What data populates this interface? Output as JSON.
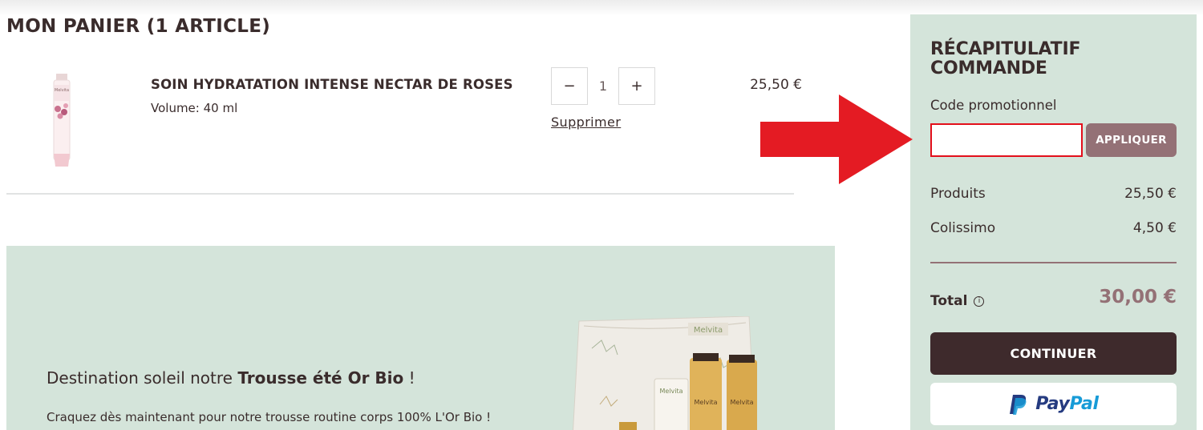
{
  "cart": {
    "title": "MON PANIER (1 ARTICLE)",
    "item": {
      "name": "SOIN HYDRATATION INTENSE NECTAR DE ROSES",
      "variant": "Volume: 40 ml",
      "quantity": "1",
      "decrease_label": "−",
      "increase_label": "+",
      "remove_label": "Supprimer",
      "price": "25,50 €",
      "image_brand": "Melvita"
    }
  },
  "banner": {
    "headline_prefix": "Destination soleil notre ",
    "headline_bold": "Trousse été Or Bio",
    "headline_suffix": " !",
    "text": "Craquez dès maintenant pour notre trousse routine corps 100% L'Or Bio !",
    "image_brand": "Melvita"
  },
  "summary": {
    "title": "RÉCAPITULATIF COMMANDE",
    "promo_label": "Code promotionnel",
    "promo_value": "",
    "apply_label": "APPLIQUER",
    "products_label": "Produits",
    "products_value": "25,50 €",
    "shipping_label": "Colissimo",
    "shipping_value": "4,50 €",
    "total_label": "Total",
    "total_info": "i",
    "total_value": "30,00 €",
    "continue_label": "CONTINUER",
    "paypal_label_a": "Pay",
    "paypal_label_b": "Pal"
  },
  "colors": {
    "panel_bg": "#d4e4da",
    "accent_mauve": "#947176",
    "dark_button": "#3e2a2c",
    "highlight_red": "#e30f1b"
  },
  "icons": [
    "info-icon",
    "paypal-logo-icon",
    "arrow-pointer-icon"
  ]
}
